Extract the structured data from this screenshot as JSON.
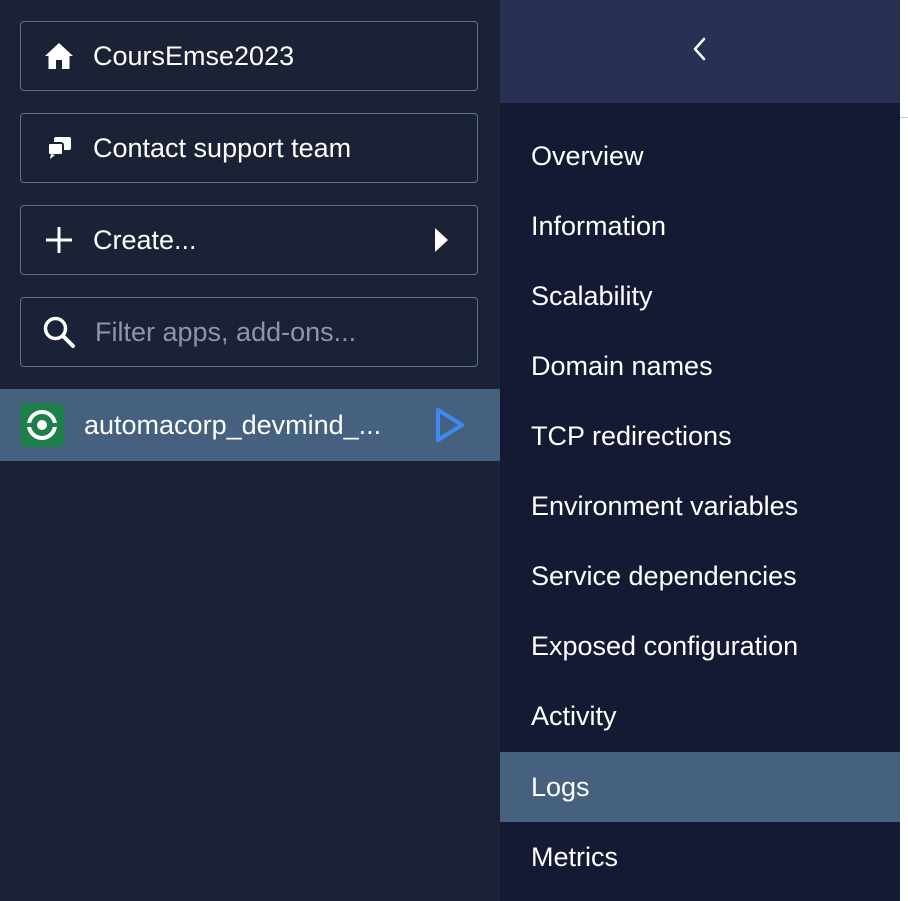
{
  "sidebar": {
    "home": {
      "label": "CoursEmse2023",
      "icon": "home-icon"
    },
    "support": {
      "label": "Contact support team",
      "icon": "chat-icon"
    },
    "create": {
      "label": "Create...",
      "icon": "plus-icon"
    },
    "filter": {
      "placeholder": "Filter apps, add-ons...",
      "value": ""
    },
    "app": {
      "name": "automacorp_devmind_...",
      "icon": "app-logo-icon",
      "status_icon": "play-icon"
    }
  },
  "panel": {
    "back_icon": "chevron-left-icon",
    "items": [
      {
        "label": "Overview"
      },
      {
        "label": "Information"
      },
      {
        "label": "Scalability"
      },
      {
        "label": "Domain names"
      },
      {
        "label": "TCP redirections"
      },
      {
        "label": "Environment variables"
      },
      {
        "label": "Service dependencies"
      },
      {
        "label": "Exposed configuration"
      },
      {
        "label": "Activity"
      },
      {
        "label": "Logs",
        "active": true
      },
      {
        "label": "Metrics"
      }
    ]
  },
  "colors": {
    "sidebar_bg": "#1c2235",
    "panel_bg": "#141a34",
    "panel_header_bg": "#283152",
    "active_bg": "#46607f",
    "border": "#59708d",
    "accent_blue": "#3d8bf0",
    "app_logo_green": "#1f7f4a"
  }
}
